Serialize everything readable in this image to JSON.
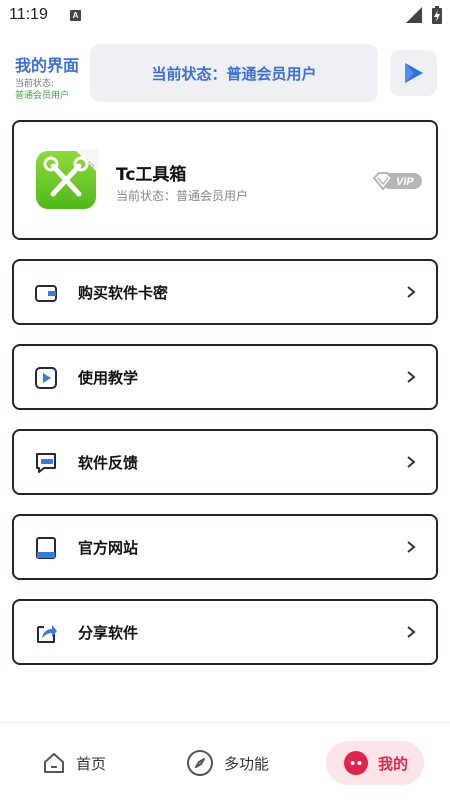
{
  "status_bar": {
    "time": "11:19",
    "notification_glyph": "A"
  },
  "header": {
    "title": "我的界面",
    "subtitle_label": "当前状态:",
    "subtitle_value": "普通会员用户",
    "status_banner": "当前状态：普通会员用户",
    "play_icon": "play-icon"
  },
  "app_card": {
    "name": "Tc工具箱",
    "status": "当前状态：普通会员用户",
    "badge": "VIP",
    "icon_tag": "pro"
  },
  "menu": [
    {
      "label": "购买软件卡密",
      "icon": "wallet-icon"
    },
    {
      "label": "使用教学",
      "icon": "video-play-icon"
    },
    {
      "label": "软件反馈",
      "icon": "feedback-icon"
    },
    {
      "label": "官方网站",
      "icon": "book-icon"
    },
    {
      "label": "分享软件",
      "icon": "share-icon"
    }
  ],
  "bottom_nav": [
    {
      "label": "首页",
      "icon": "home-icon",
      "active": false
    },
    {
      "label": "多功能",
      "icon": "compass-icon",
      "active": false
    },
    {
      "label": "我的",
      "icon": "profile-icon",
      "active": true
    }
  ],
  "colors": {
    "accent_blue": "#3d6fd6",
    "accent_green": "#43a047",
    "active_pink": "#e0254d",
    "active_pink_bg": "#fde4e9",
    "card_border": "#1f2a1f"
  }
}
